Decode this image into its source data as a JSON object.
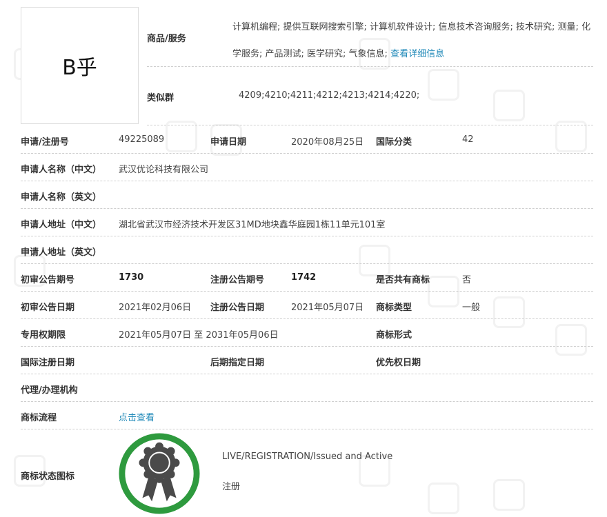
{
  "logo": {
    "text": "B乎"
  },
  "goods_services": {
    "label": "商品/服务",
    "text": "计算机编程; 提供互联网搜索引擎; 计算机软件设计; 信息技术咨询服务; 技术研究; 测量; 化学服务; 产品测试; 医学研究; 气象信息;",
    "detail_link": "查看详细信息"
  },
  "similar_group": {
    "label": "类似群",
    "value": "4209;4210;4211;4212;4213;4214;4220;"
  },
  "fields": {
    "reg_no_label": "申请/注册号",
    "reg_no": "49225089",
    "apply_date_label": "申请日期",
    "apply_date": "2020年08月25日",
    "intl_class_label": "国际分类",
    "intl_class": "42",
    "applicant_cn_label": "申请人名称（中文）",
    "applicant_cn": "武汉优论科技有限公司",
    "applicant_en_label": "申请人名称（英文）",
    "address_cn_label": "申请人地址（中文）",
    "address_cn": "湖北省武汉市经济技术开发区31MD地块鑫华庭园1栋11单元101室",
    "address_en_label": "申请人地址（英文）",
    "prelim_no_label": "初审公告期号",
    "prelim_no": "1730",
    "reg_pub_no_label": "注册公告期号",
    "reg_pub_no": "1742",
    "shared_label": "是否共有商标",
    "shared": "否",
    "prelim_date_label": "初审公告日期",
    "prelim_date": "2021年02月06日",
    "reg_pub_date_label": "注册公告日期",
    "reg_pub_date": "2021年05月07日",
    "tm_type_label": "商标类型",
    "tm_type": "一般",
    "exclusive_label": "专用权期限",
    "exclusive": "2021年05月07日 至 2031年05月06日",
    "tm_form_label": "商标形式",
    "intl_reg_date_label": "国际注册日期",
    "later_date_label": "后期指定日期",
    "priority_label": "优先权日期",
    "agent_label": "代理/办理机构",
    "flow_label": "商标流程",
    "flow_link": "点击查看",
    "status_icon_label": "商标状态图标"
  },
  "status": {
    "english": "LIVE/REGISTRATION/Issued and Active",
    "chinese": "注册"
  },
  "colors": {
    "seal_ring": "#2e9a3e",
    "seal_rosette": "#4a4a4a",
    "link": "#1e88b8"
  }
}
